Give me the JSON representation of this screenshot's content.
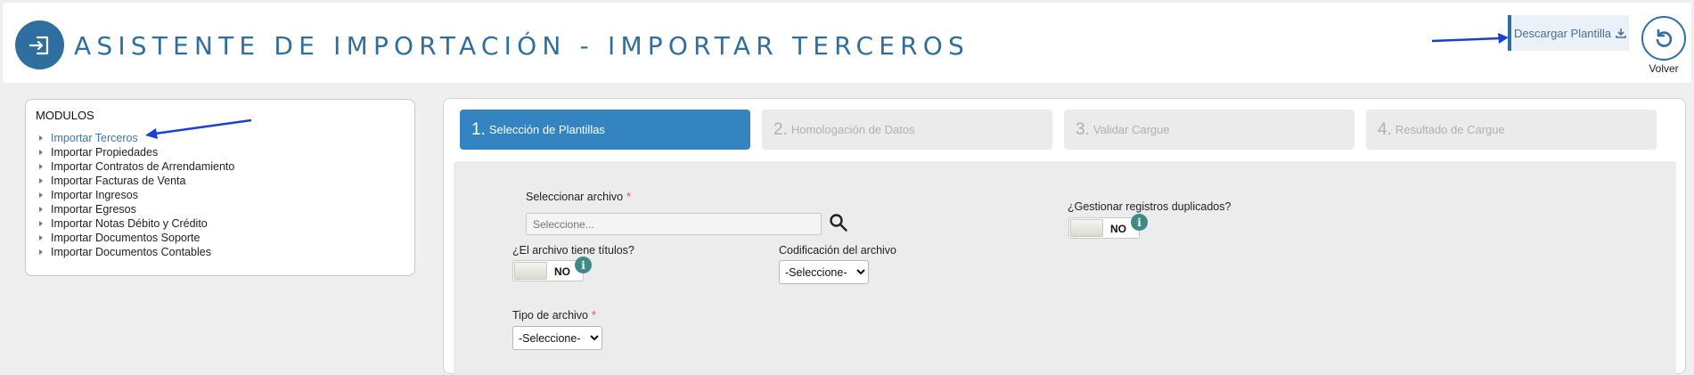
{
  "header": {
    "title": "ASISTENTE DE IMPORTACIÓN - IMPORTAR TERCEROS",
    "download_label": "Descargar Plantilla",
    "back_label": "Volver",
    "accent_color": "#2f6f9f"
  },
  "modules": {
    "title": "MODULOS",
    "items": [
      {
        "label": "Importar Terceros",
        "active": true
      },
      {
        "label": "Importar Propiedades"
      },
      {
        "label": "Importar Contratos de Arrendamiento"
      },
      {
        "label": "Importar Facturas de Venta"
      },
      {
        "label": "Importar Ingresos"
      },
      {
        "label": "Importar Egresos"
      },
      {
        "label": "Importar Notas Débito y Crédito"
      },
      {
        "label": "Importar Documentos Soporte"
      },
      {
        "label": "Importar Documentos Contables"
      }
    ]
  },
  "steps": [
    {
      "num": "1.",
      "label": "Selección de Plantillas",
      "active": true
    },
    {
      "num": "2.",
      "label": "Homologación de Datos"
    },
    {
      "num": "3.",
      "label": "Validar Cargue"
    },
    {
      "num": "4.",
      "label": "Resultado de Cargue"
    }
  ],
  "form": {
    "file_label": "Seleccionar archivo",
    "required_mark": "*",
    "file_placeholder": "Seleccione...",
    "has_titles_label": "¿El archivo tiene títulos?",
    "has_titles_value": "NO",
    "encoding_label": "Codificación del archivo",
    "encoding_value": "-Seleccione-",
    "duplicates_label": "¿Gestionar registros duplicados?",
    "duplicates_value": "NO",
    "file_type_label": "Tipo de archivo",
    "file_type_value": "-Seleccione-",
    "info_glyph": "i"
  }
}
